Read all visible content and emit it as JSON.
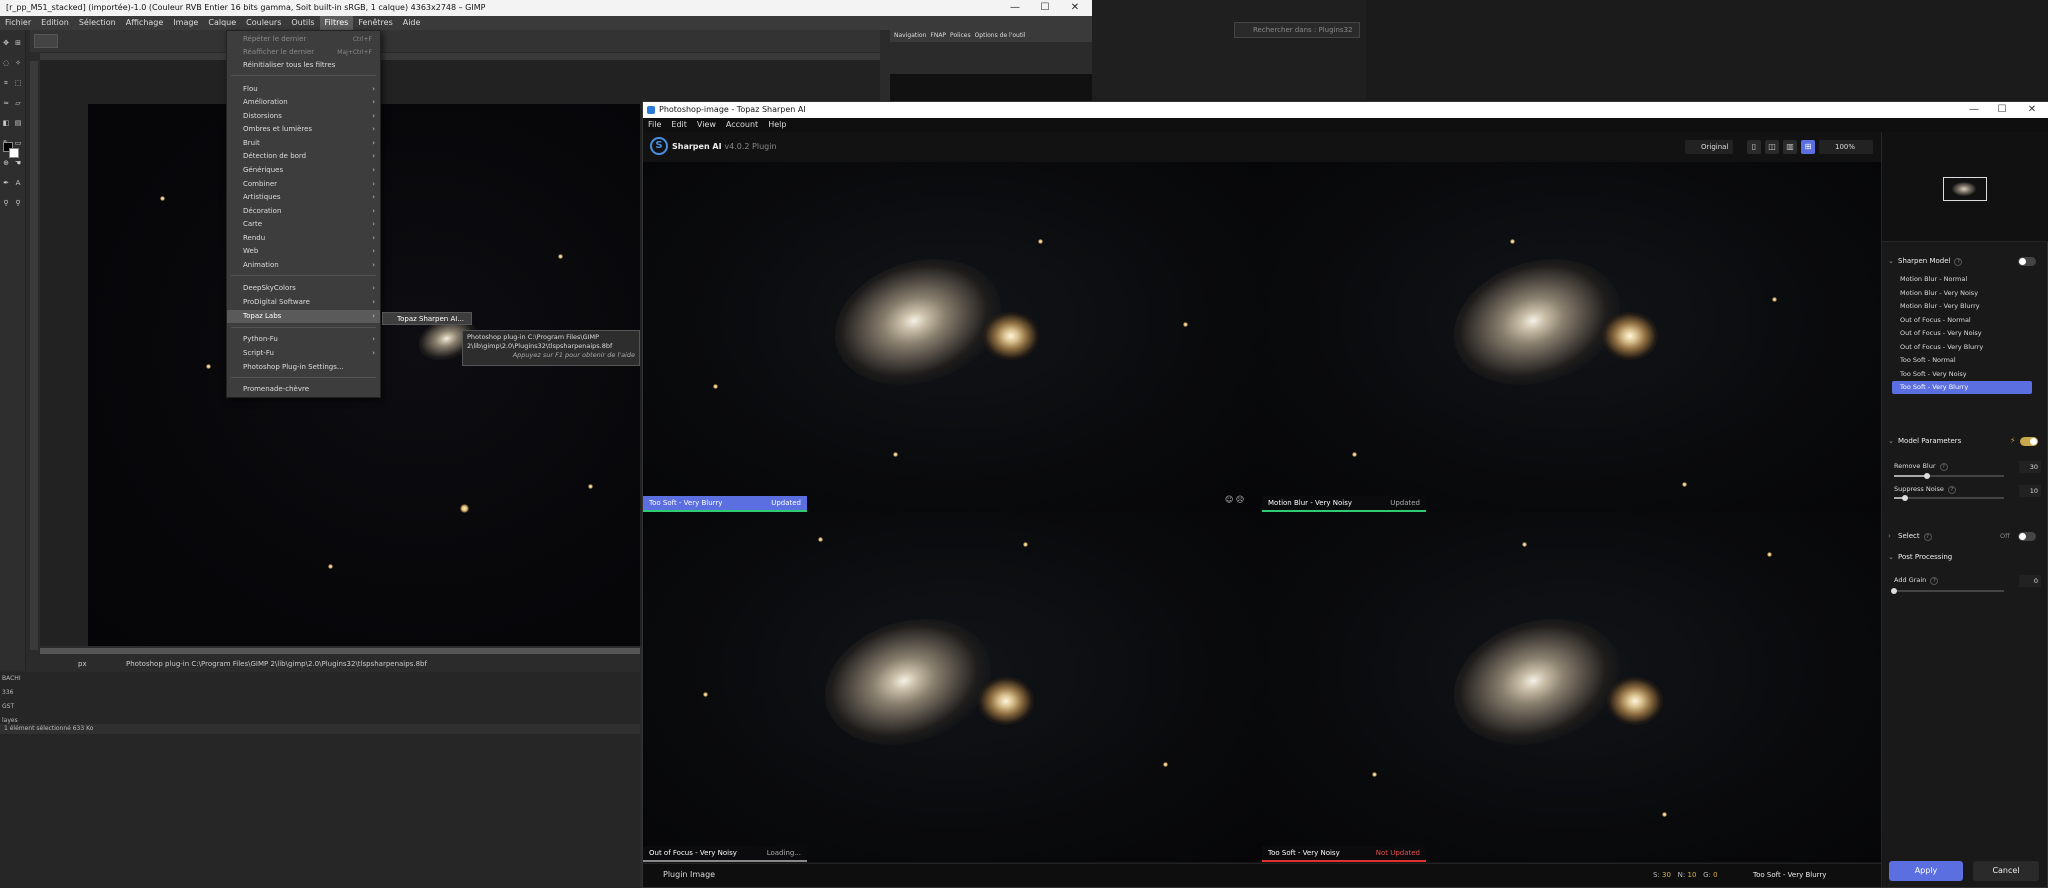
{
  "gimp": {
    "title": "[r_pp_M51_stacked] (importée)-1.0 (Couleur RVB Entier 16 bits gamma, Soit built-in sRGB, 1 calque) 4363x2748 – GIMP",
    "window_controls": [
      "—",
      "☐",
      "✕"
    ],
    "menus": [
      "Fichier",
      "Edition",
      "Sélection",
      "Affichage",
      "Image",
      "Calque",
      "Couleurs",
      "Outils",
      "Filtres",
      "Fenêtres",
      "Aide"
    ],
    "dock_tabs": [
      "Navigation",
      "FNAP",
      "Polices",
      "Options de l'outil"
    ],
    "search_placeholder": "Rechercher dans : Plugins32",
    "status_unit": "px",
    "status_text": "Photoshop plug-in C:\\Program Files\\GIMP 2\\lib\\gimp\\2.0\\Plugins32\\tlspsharpenaips.8bf",
    "lower_rows": [
      "BACHI",
      "336",
      "GST",
      "layes"
    ],
    "lower_status": "1 élément sélectionné  633 Ko"
  },
  "filters_menu": {
    "items": [
      {
        "label": "Répéter le dernier",
        "shortcut": "Ctrl+F",
        "disabled": true,
        "submenu": false
      },
      {
        "label": "Réafficher le dernier",
        "shortcut": "Maj+Ctrl+F",
        "disabled": true,
        "submenu": false
      },
      {
        "label": "Réinitialiser tous les filtres",
        "shortcut": "",
        "disabled": false,
        "submenu": false
      },
      {
        "label": "Flou",
        "shortcut": "",
        "disabled": false,
        "submenu": true
      },
      {
        "label": "Amélioration",
        "shortcut": "",
        "disabled": false,
        "submenu": true
      },
      {
        "label": "Distorsions",
        "shortcut": "",
        "disabled": false,
        "submenu": true
      },
      {
        "label": "Ombres et lumières",
        "shortcut": "",
        "disabled": false,
        "submenu": true
      },
      {
        "label": "Bruit",
        "shortcut": "",
        "disabled": false,
        "submenu": true
      },
      {
        "label": "Détection de bord",
        "shortcut": "",
        "disabled": false,
        "submenu": true
      },
      {
        "label": "Génériques",
        "shortcut": "",
        "disabled": false,
        "submenu": true
      },
      {
        "label": "Combiner",
        "shortcut": "",
        "disabled": false,
        "submenu": true
      },
      {
        "label": "Artistiques",
        "shortcut": "",
        "disabled": false,
        "submenu": true
      },
      {
        "label": "Décoration",
        "shortcut": "",
        "disabled": false,
        "submenu": true
      },
      {
        "label": "Carte",
        "shortcut": "",
        "disabled": false,
        "submenu": true
      },
      {
        "label": "Rendu",
        "shortcut": "",
        "disabled": false,
        "submenu": true
      },
      {
        "label": "Web",
        "shortcut": "",
        "disabled": false,
        "submenu": true
      },
      {
        "label": "Animation",
        "shortcut": "",
        "disabled": false,
        "submenu": true
      },
      {
        "label": "DeepSkyColors",
        "shortcut": "",
        "disabled": false,
        "submenu": true
      },
      {
        "label": "ProDigital Software",
        "shortcut": "",
        "disabled": false,
        "submenu": true
      },
      {
        "label": "Topaz Labs",
        "shortcut": "",
        "disabled": false,
        "submenu": true
      },
      {
        "label": "Python-Fu",
        "shortcut": "",
        "disabled": false,
        "submenu": true
      },
      {
        "label": "Script-Fu",
        "shortcut": "",
        "disabled": false,
        "submenu": true
      },
      {
        "label": "Photoshop Plug-in Settings...",
        "shortcut": "",
        "disabled": false,
        "submenu": false
      },
      {
        "label": "Promenade-chèvre",
        "shortcut": "",
        "disabled": false,
        "submenu": false
      }
    ],
    "topaz_submenu": "Topaz Sharpen AI...",
    "tooltip_line1": "Photoshop plug-in C:\\Program Files\\GIMP",
    "tooltip_line2": "2\\lib\\gimp\\2.0\\Plugins32\\tlspsharpenaips.8bf",
    "tooltip_hint": "Appuyez sur F1 pour obtenir de l'aide"
  },
  "topaz": {
    "title": "Photoshop-image - Topaz Sharpen AI",
    "window_controls": [
      "—",
      "☐",
      "✕"
    ],
    "menus": [
      "File",
      "Edit",
      "View",
      "Account",
      "Help"
    ],
    "app_name": "Sharpen AI",
    "app_version": "v4.0.2 Plugin",
    "original_label": "Original",
    "zoom_label": "100%",
    "panes": [
      {
        "model": "Too Soft - Very Blurry",
        "status": "Updated",
        "status_color": "#ffffff",
        "bg": "#5b6fe0",
        "underline": "#2ecc71"
      },
      {
        "model": "Motion Blur - Very Noisy",
        "status": "Updated",
        "status_color": "#aaaaaa",
        "bg": "#0b0b0d",
        "underline": "#2ecc71"
      },
      {
        "model": "Out of Focus - Very Noisy",
        "status": "Loading...",
        "status_color": "#aaaaaa",
        "bg": "#0b0b0d",
        "underline": "#888888"
      },
      {
        "model": "Too Soft - Very Noisy",
        "status": "Not Updated",
        "status_color": "#e05050",
        "bg": "#0b0b0d",
        "underline": "#e03030"
      }
    ],
    "plugin_image_label": "Plugin Image",
    "snr": {
      "s_label": "S:",
      "s_value": "30",
      "n_label": "N:",
      "n_value": "10",
      "g_label": "G:",
      "g_value": "0"
    },
    "current_model": "Too Soft - Very Blurry",
    "panel": {
      "sharpen_model_title": "Sharpen Model",
      "models": [
        "Motion Blur - Normal",
        "Motion Blur - Very Noisy",
        "Motion Blur - Very Blurry",
        "Out of Focus - Normal",
        "Out of Focus - Very Noisy",
        "Out of Focus - Very Blurry",
        "Too Soft - Normal",
        "Too Soft - Very Noisy",
        "Too Soft - Very Blurry"
      ],
      "selected_model_index": 8,
      "model_params_title": "Model Parameters",
      "remove_blur_label": "Remove Blur",
      "remove_blur_value": "30",
      "remove_blur_fraction": 0.3,
      "suppress_noise_label": "Suppress Noise",
      "suppress_noise_value": "10",
      "suppress_noise_fraction": 0.1,
      "select_title": "Select",
      "select_state": "Off",
      "post_processing_title": "Post Processing",
      "add_grain_label": "Add Grain",
      "add_grain_value": "0",
      "add_grain_fraction": 0
    },
    "apply_label": "Apply",
    "cancel_label": "Cancel",
    "accent_color": "#5b6fe0"
  }
}
